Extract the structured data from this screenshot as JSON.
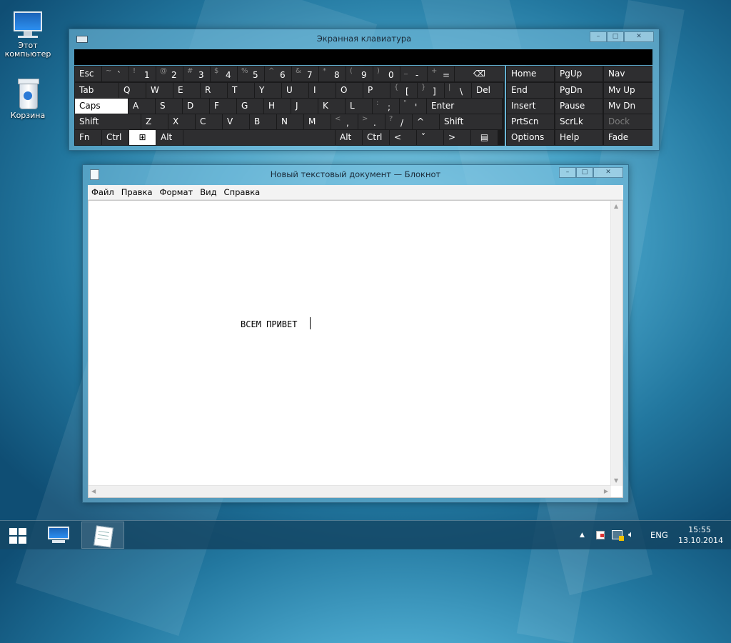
{
  "desktop": {
    "icons": [
      {
        "label": "Этот компьютер",
        "icon": "computer-icon"
      },
      {
        "label": "Корзина",
        "icon": "recycle-bin-icon"
      }
    ]
  },
  "osk": {
    "title": "Экранная клавиатура",
    "controls": {
      "minimize": "–",
      "maximize": "□",
      "close": "✕"
    },
    "rows": [
      [
        {
          "label": "Esc"
        },
        {
          "sub": "~",
          "main": "`"
        },
        {
          "sub": "!",
          "main": "1"
        },
        {
          "sub": "@",
          "main": "2"
        },
        {
          "sub": "#",
          "main": "3"
        },
        {
          "sub": "$",
          "main": "4"
        },
        {
          "sub": "%",
          "main": "5"
        },
        {
          "sub": "^",
          "main": "6"
        },
        {
          "sub": "&",
          "main": "7"
        },
        {
          "sub": "*",
          "main": "8"
        },
        {
          "sub": "(",
          "main": "9"
        },
        {
          "sub": ")",
          "main": "0"
        },
        {
          "sub": "_",
          "main": "-"
        },
        {
          "sub": "+",
          "main": "="
        },
        {
          "label": "⌫",
          "icon": "backspace-icon"
        }
      ],
      [
        {
          "label": "Tab"
        },
        {
          "label": "Q"
        },
        {
          "label": "W"
        },
        {
          "label": "E"
        },
        {
          "label": "R"
        },
        {
          "label": "T"
        },
        {
          "label": "Y"
        },
        {
          "label": "U"
        },
        {
          "label": "I"
        },
        {
          "label": "O"
        },
        {
          "label": "P"
        },
        {
          "sub": "{",
          "main": "["
        },
        {
          "sub": "}",
          "main": "]"
        },
        {
          "sub": "|",
          "main": "\\"
        },
        {
          "label": "Del"
        }
      ],
      [
        {
          "label": "Caps",
          "active": true
        },
        {
          "label": "A"
        },
        {
          "label": "S"
        },
        {
          "label": "D"
        },
        {
          "label": "F"
        },
        {
          "label": "G"
        },
        {
          "label": "H"
        },
        {
          "label": "J"
        },
        {
          "label": "K"
        },
        {
          "label": "L"
        },
        {
          "sub": ":",
          "main": ";"
        },
        {
          "sub": "\"",
          "main": "'"
        },
        {
          "label": "Enter"
        }
      ],
      [
        {
          "label": "Shift"
        },
        {
          "label": "Z"
        },
        {
          "label": "X"
        },
        {
          "label": "C"
        },
        {
          "label": "V"
        },
        {
          "label": "B"
        },
        {
          "label": "N"
        },
        {
          "label": "M"
        },
        {
          "sub": "<",
          "main": ","
        },
        {
          "sub": ">",
          "main": "."
        },
        {
          "sub": "?",
          "main": "/"
        },
        {
          "label": "^"
        },
        {
          "label": "Shift"
        }
      ],
      [
        {
          "label": "Fn"
        },
        {
          "label": "Ctrl"
        },
        {
          "label": "⊞",
          "icon": "windows-key-icon",
          "active": true
        },
        {
          "label": "Alt"
        },
        {
          "label": ""
        },
        {
          "label": "Alt"
        },
        {
          "label": "Ctrl"
        },
        {
          "label": "<"
        },
        {
          "label": "˅"
        },
        {
          "label": ">"
        },
        {
          "label": "▤",
          "icon": "context-menu-key-icon"
        }
      ]
    ],
    "nav": [
      [
        "Home",
        "PgUp"
      ],
      [
        "End",
        "PgDn"
      ],
      [
        "Insert",
        "Pause"
      ],
      [
        "PrtScn",
        "ScrLk"
      ],
      [
        "Options",
        "Help"
      ]
    ],
    "side": [
      {
        "label": "Nav"
      },
      {
        "label": "Mv Up"
      },
      {
        "label": "Mv Dn"
      },
      {
        "label": "Dock",
        "dim": true
      },
      {
        "label": "Fade"
      }
    ]
  },
  "notepad": {
    "title": "Новый текстовый документ — Блокнот",
    "controls": {
      "minimize": "–",
      "maximize": "□",
      "close": "✕"
    },
    "menu": [
      "Файл",
      "Правка",
      "Формат",
      "Вид",
      "Справка"
    ],
    "content": "ВСЕМ ПРИВЕТ"
  },
  "taskbar": {
    "buttons": [
      {
        "name": "start-button",
        "icon": "windows-logo-icon"
      },
      {
        "name": "explorer-button",
        "icon": "computer-icon"
      },
      {
        "name": "notepad-button",
        "icon": "notepad-icon"
      }
    ],
    "tray": {
      "overflow": "▲",
      "language": "ENG",
      "time": "15:55",
      "date": "13.10.2014"
    }
  }
}
